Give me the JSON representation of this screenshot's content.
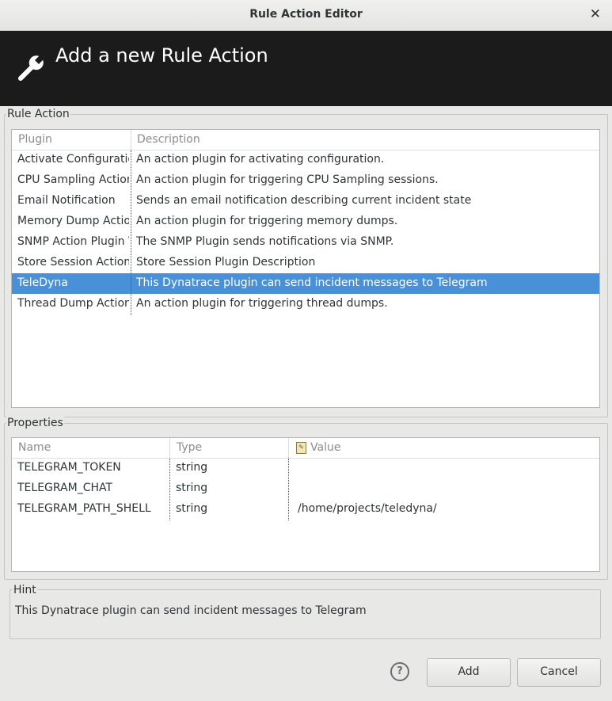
{
  "window": {
    "title": "Rule Action Editor"
  },
  "banner": {
    "heading": "Add a new Rule Action",
    "icon": "wrench-icon"
  },
  "rule_action": {
    "label": "Rule Action",
    "columns": [
      "Plugin",
      "Description"
    ],
    "rows": [
      {
        "plugin": "Activate Configuration",
        "description": "An action plugin for activating configuration."
      },
      {
        "plugin": "CPU Sampling Action P",
        "description": "An action plugin for triggering CPU Sampling sessions."
      },
      {
        "plugin": "Email Notification",
        "description": "Sends an email notification describing current incident state"
      },
      {
        "plugin": "Memory Dump Action",
        "description": "An action plugin for triggering memory dumps."
      },
      {
        "plugin": "SNMP Action Plugin V",
        "description": "The SNMP Plugin sends notifications via SNMP."
      },
      {
        "plugin": "Store Session Action P",
        "description": "Store Session Plugin Description"
      },
      {
        "plugin": "TeleDyna",
        "description": "This Dynatrace plugin can send incident messages to Telegram",
        "selected": true
      },
      {
        "plugin": "Thread Dump Action P",
        "description": "An action plugin for triggering thread dumps."
      }
    ]
  },
  "properties": {
    "label": "Properties",
    "columns": [
      "Name",
      "Type",
      "Value"
    ],
    "rows": [
      {
        "name": "TELEGRAM_TOKEN",
        "type": "string",
        "value": ""
      },
      {
        "name": "TELEGRAM_CHAT",
        "type": "string",
        "value": ""
      },
      {
        "name": "TELEGRAM_PATH_SHELL",
        "type": "string",
        "value": "/home/projects/teledyna/"
      }
    ]
  },
  "hint": {
    "label": "Hint",
    "text": "This Dynatrace plugin can send incident messages to Telegram"
  },
  "buttons": {
    "help": "?",
    "add": "Add",
    "cancel": "Cancel"
  },
  "colors": {
    "selection": "#4a90d9",
    "banner": "#1b1b1b"
  }
}
